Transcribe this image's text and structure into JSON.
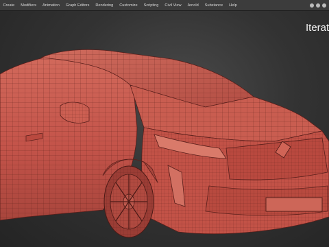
{
  "menubar": {
    "items": [
      {
        "label": "Create"
      },
      {
        "label": "Modifiers"
      },
      {
        "label": "Animation"
      },
      {
        "label": "Graph Editors"
      },
      {
        "label": "Rendering"
      },
      {
        "label": "Customize"
      },
      {
        "label": "Scripting"
      },
      {
        "label": "Civil View"
      },
      {
        "label": "Arnold"
      },
      {
        "label": "Substance"
      },
      {
        "label": "Help"
      }
    ]
  },
  "viewport": {
    "label": "Iterat",
    "model_color": "#c6564a",
    "wire_color": "#5a1f1b",
    "background_color": "#3a3a3a"
  },
  "icons": {
    "window_controls": [
      "window-dot-icon",
      "window-dot-icon",
      "window-dot-icon"
    ]
  }
}
